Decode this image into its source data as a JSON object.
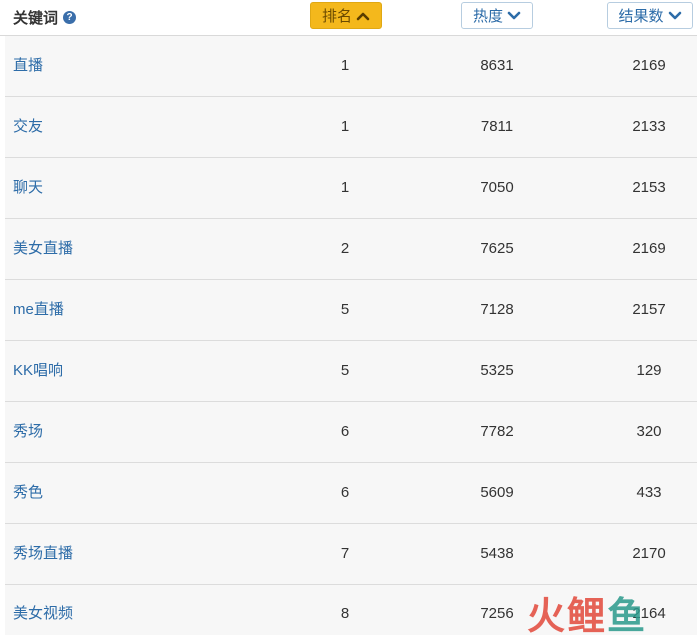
{
  "header": {
    "keyword_label": "关键词",
    "help_icon": "?",
    "rank_label": "排名",
    "heat_label": "热度",
    "results_label": "结果数"
  },
  "rows": [
    {
      "keyword": "直播",
      "rank": "1",
      "heat": "8631",
      "results": "2169"
    },
    {
      "keyword": "交友",
      "rank": "1",
      "heat": "7811",
      "results": "2133"
    },
    {
      "keyword": "聊天",
      "rank": "1",
      "heat": "7050",
      "results": "2153"
    },
    {
      "keyword": "美女直播",
      "rank": "2",
      "heat": "7625",
      "results": "2169"
    },
    {
      "keyword": "me直播",
      "rank": "5",
      "heat": "7128",
      "results": "2157"
    },
    {
      "keyword": "KK唱响",
      "rank": "5",
      "heat": "5325",
      "results": "129"
    },
    {
      "keyword": "秀场",
      "rank": "6",
      "heat": "7782",
      "results": "320"
    },
    {
      "keyword": "秀色",
      "rank": "6",
      "heat": "5609",
      "results": "433"
    },
    {
      "keyword": "秀场直播",
      "rank": "7",
      "heat": "5438",
      "results": "2170"
    },
    {
      "keyword": "美女视频",
      "rank": "8",
      "heat": "7256",
      "results": "2164"
    }
  ],
  "watermark": {
    "c1": "火",
    "c2": "鲤",
    "c3": "鱼"
  },
  "colors": {
    "accent": "#f4b81c",
    "link": "#2d6ca8",
    "row_bg": "#f7f7f7"
  }
}
